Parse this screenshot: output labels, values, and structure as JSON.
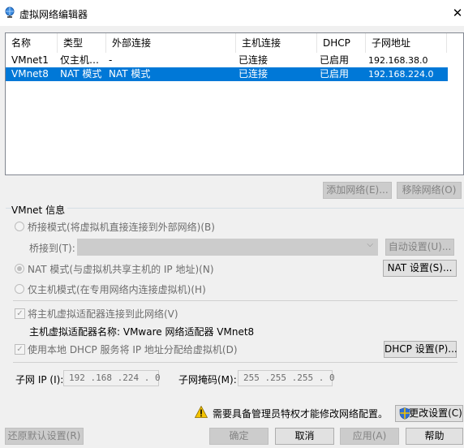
{
  "window": {
    "title": "虚拟网络编辑器",
    "close_glyph": "✕"
  },
  "table": {
    "headers": {
      "name": "名称",
      "type": "类型",
      "external": "外部连接",
      "host": "主机连接",
      "dhcp": "DHCP",
      "subnet": "子网地址"
    },
    "rows": [
      {
        "name": "VMnet1",
        "type": "仅主机…",
        "external": "-",
        "host": "已连接",
        "dhcp": "已启用",
        "subnet": "192.168.38.0",
        "selected": false
      },
      {
        "name": "VMnet8",
        "type": "NAT 模式",
        "external": "NAT 模式",
        "host": "已连接",
        "dhcp": "已启用",
        "subnet": "192.168.224.0",
        "selected": true
      }
    ]
  },
  "list_buttons": {
    "add": "添加网络(E)...",
    "remove": "移除网络(O)"
  },
  "vmnet_info": {
    "group_title": "VMnet 信息",
    "bridge_label": "桥接模式(将虚拟机直接连接到外部网络)(B)",
    "bridge_to_label": "桥接到(T):",
    "bridge_to_value": "",
    "auto_settings": "自动设置(U)...",
    "nat_label": "NAT 模式(与虚拟机共享主机的 IP 地址)(N)",
    "nat_settings": "NAT 设置(S)...",
    "hostonly_label": "仅主机模式(在专用网络内连接虚拟机)(H)",
    "connect_adapter_label": "将主机虚拟适配器连接到此网络(V)",
    "adapter_name_label": "主机虚拟适配器名称: VMware 网络适配器 VMnet8",
    "dhcp_label": "使用本地 DHCP 服务将 IP 地址分配给虚拟机(D)",
    "dhcp_settings": "DHCP 设置(P)...",
    "subnet_ip_label": "子网 IP (I):",
    "subnet_ip_value": "192 .168 .224 . 0",
    "subnet_mask_label": "子网掩码(M):",
    "subnet_mask_value": "255 .255 .255 . 0"
  },
  "footer": {
    "admin_notice": "需要具备管理员特权才能修改网络配置。",
    "change_settings": "更改设置(C)",
    "restore_defaults": "还原默认设置(R)",
    "ok": "确定",
    "cancel": "取消",
    "apply": "应用(A)",
    "help": "帮助"
  },
  "colors": {
    "selection": "#0078d7",
    "warning": "#f5c400",
    "shield_blue": "#2f6fd6",
    "shield_yellow": "#f2c200"
  }
}
